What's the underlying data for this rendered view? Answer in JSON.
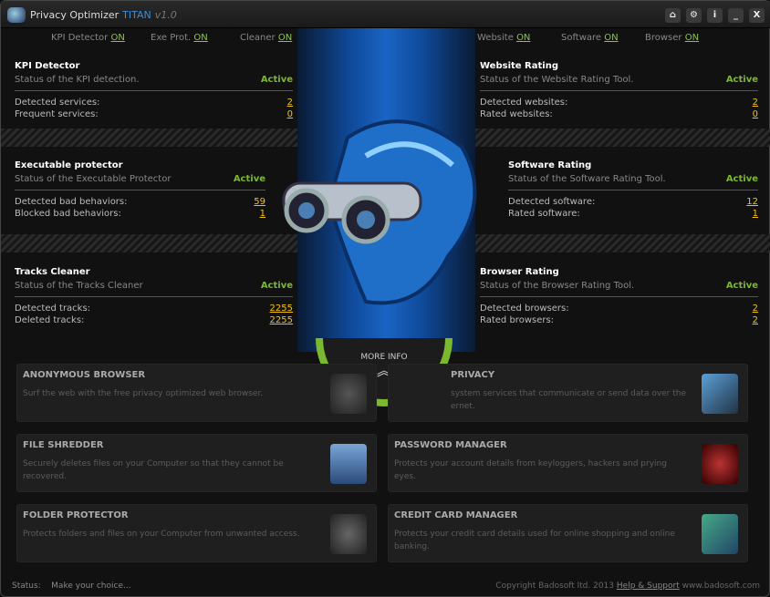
{
  "titlebar": {
    "app": "Privacy Optimizer",
    "edition": "TITAN",
    "version": "v1.0",
    "buttons": [
      "home",
      "settings",
      "info",
      "minimize",
      "close"
    ],
    "close_label": "X",
    "info_label": "i"
  },
  "toggles": [
    {
      "label": "KPI Detector",
      "state": "ON"
    },
    {
      "label": "Exe Prot.",
      "state": "ON"
    },
    {
      "label": "Cleaner",
      "state": "ON"
    },
    {
      "label": "Website",
      "state": "ON"
    },
    {
      "label": "Software",
      "state": "ON"
    },
    {
      "label": "Browser",
      "state": "ON"
    }
  ],
  "panels": [
    {
      "title": "KPI Detector",
      "status_text": "Status of the KPI detection.",
      "status": "Active",
      "rows": [
        {
          "label": "Detected services:",
          "value": "2"
        },
        {
          "label": "Frequent services:",
          "value": "0"
        }
      ]
    },
    {
      "title": "Executable protector",
      "status_text": "Status of the Executable Protector",
      "status": "Active",
      "rows": [
        {
          "label": "Detected bad behaviors:",
          "value": "59"
        },
        {
          "label": "Blocked bad behaviors:",
          "value": "1"
        }
      ]
    },
    {
      "title": "Tracks Cleaner",
      "status_text": "Status of the Tracks Cleaner",
      "status": "Active",
      "rows": [
        {
          "label": "Detected tracks:",
          "value": "2255"
        },
        {
          "label": "Deleted tracks:",
          "value": "2255"
        }
      ]
    },
    {
      "title": "Website Rating",
      "status_text": "Status of the Website Rating Tool.",
      "status": "Active",
      "rows": [
        {
          "label": "Detected websites:",
          "value": "2"
        },
        {
          "label": "Rated websites:",
          "value": "0"
        }
      ]
    },
    {
      "title": "Software Rating",
      "status_text": "Status of the Software Rating Tool.",
      "status": "Active",
      "rows": [
        {
          "label": "Detected software:",
          "value": "12"
        },
        {
          "label": "Rated software:",
          "value": "1"
        }
      ]
    },
    {
      "title": "Browser Rating",
      "status_text": "Status of the Browser Rating Tool.",
      "status": "Active",
      "rows": [
        {
          "label": "Detected browsers:",
          "value": "2"
        },
        {
          "label": "Rated browsers:",
          "value": "2"
        }
      ]
    }
  ],
  "more_info": {
    "label": "MORE INFO",
    "icon": "double-chevron-up"
  },
  "cards": [
    {
      "title": "ANONYMOUS BROWSER",
      "desc": "Surf the web with the free privacy optimized web browser."
    },
    {
      "title": "PRIVACY",
      "desc": "system services that communicate or send data over the ernet."
    },
    {
      "title": "FILE SHREDDER",
      "desc": "Securely deletes files on your Computer so that they cannot be recovered."
    },
    {
      "title": "PASSWORD MANAGER",
      "desc": "Protects your account details from keyloggers, hackers and prying eyes."
    },
    {
      "title": "FOLDER PROTECTOR",
      "desc": "Protects folders and files on your Computer from unwanted access."
    },
    {
      "title": "CREDIT CARD MANAGER",
      "desc": "Protects your credit card details used for online shopping and online banking."
    }
  ],
  "statusbar": {
    "label": "Status:",
    "text": "Make your choice...",
    "copyright": "Copyright Badosoft ltd. 2013",
    "help": "Help & Support",
    "site": "www.badosoft.com"
  },
  "colors": {
    "accent": "#7cb82f",
    "value": "#f4c20d",
    "edition": "#3b8fd8"
  }
}
